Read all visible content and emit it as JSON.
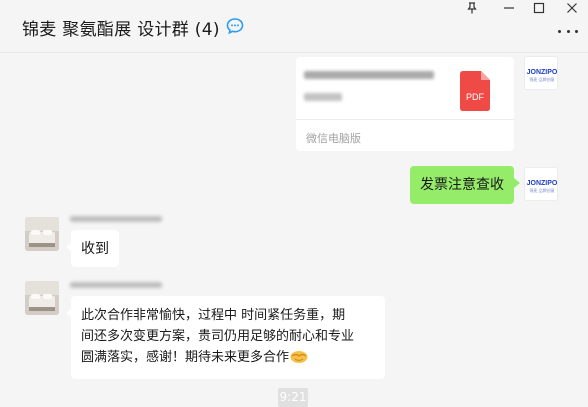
{
  "header": {
    "title": "锦麦 聚氨酯展 设计群 (4)"
  },
  "window_controls": {
    "pin": "pin-icon",
    "minimize": "minimize-icon",
    "maximize": "maximize-icon",
    "close": "close-icon",
    "more": "more-options-icon"
  },
  "messages": {
    "file": {
      "file_type": "PDF",
      "source": "微信电脑版"
    },
    "invoice": {
      "text": "发票注意查收"
    },
    "reply_received": {
      "text": "收到"
    },
    "thanks": {
      "line1": "此次合作非常愉快，过程中 时间紧任务重，期",
      "line2": "间还多次变更方案，贵司仍用足够的耐心和专业",
      "line3": "圆满落实，感谢！期待未来更多合作"
    }
  },
  "avatars": {
    "self_logo_text": "JONZIPO",
    "self_logo_sub": "锦麦·品牌创意"
  },
  "timestamp": "9:21",
  "colors": {
    "background": "#f5f5f5",
    "self_bubble": "#95ec69",
    "other_bubble": "#ffffff",
    "pdf_red": "#f04a47",
    "brand_blue": "#1a3fbf"
  }
}
